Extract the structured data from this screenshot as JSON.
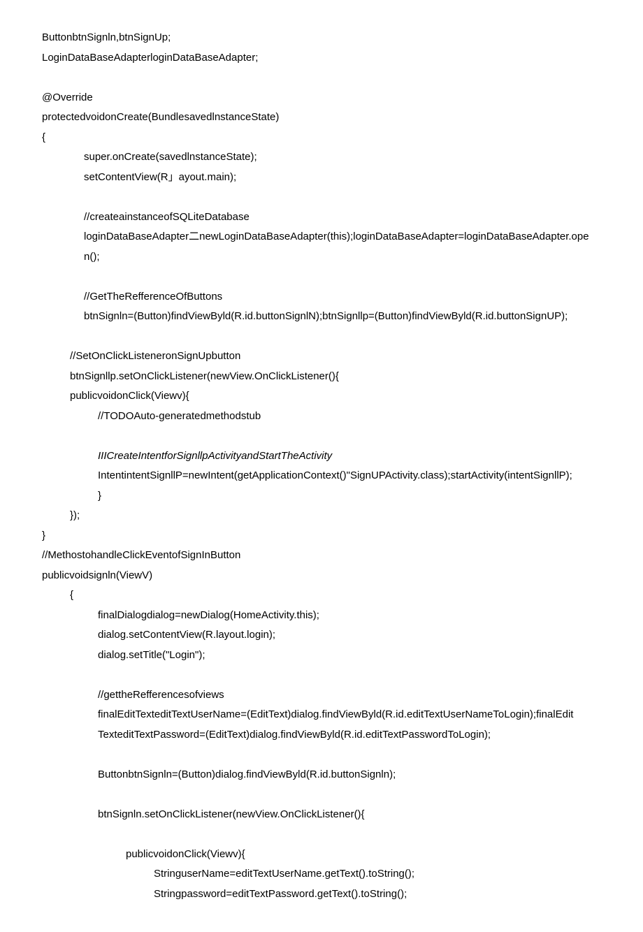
{
  "code": {
    "lines": [
      {
        "text": "ButtonbtnSignln,btnSignUp;",
        "indent": 0
      },
      {
        "text": "LoginDataBaseAdapterloginDataBaseAdapter;",
        "indent": 0
      },
      {
        "text": "",
        "indent": 0,
        "blank": true
      },
      {
        "text": "@Override",
        "indent": 0
      },
      {
        "text": "protectedvoidonCreate(BundlesavedlnstanceState)",
        "indent": 0
      },
      {
        "text": "{",
        "indent": 0
      },
      {
        "text": "super.onCreate(savedlnstanceState);",
        "indent": 1
      },
      {
        "text": "setContentView(R」ayout.main);",
        "indent": 1
      },
      {
        "text": "",
        "indent": 0,
        "blank": true
      },
      {
        "text": "//createainstanceofSQLiteDatabase",
        "indent": 1
      },
      {
        "text": "loginDataBaseAdapter二newLoginDataBaseAdapter(this);loginDataBaseAdapter=loginDataBaseAdapter.ope",
        "indent": 1
      },
      {
        "text": "n();",
        "indent": 1
      },
      {
        "text": "",
        "indent": 0,
        "blank": true
      },
      {
        "text": "//GetTheRefferenceOfButtons",
        "indent": 1
      },
      {
        "text": "btnSignln=(Button)findViewByld(R.id.buttonSignlN);btnSignllp=(Button)findViewByld(R.id.buttonSignUP);",
        "indent": 1
      },
      {
        "text": "",
        "indent": 0,
        "blank": true
      },
      {
        "text": "//SetOnClickListeneronSignUpbutton",
        "indent": 2
      },
      {
        "text": "btnSignllp.setOnClickListener(newView.OnClickListener(){",
        "indent": 2
      },
      {
        "text": "publicvoidonClick(Viewv){",
        "indent": 2
      },
      {
        "text": "//TODOAuto-generatedmethodstub",
        "indent": 3
      },
      {
        "text": "",
        "indent": 0,
        "blank": true
      },
      {
        "text": "IIICreateIntentforSignllpActivityandStartTheActivity",
        "indent": 3,
        "italic": true
      },
      {
        "text": "IntentintentSignllP=newIntent(getApplicationContext()\"SignUPActivity.class);startActivity(intentSignllP);",
        "indent": 3
      },
      {
        "text": "}",
        "indent": 3
      },
      {
        "text": "});",
        "indent": 2
      },
      {
        "text": "}",
        "indent": 0
      },
      {
        "text": "//MethostohandleClickEventofSignInButton",
        "indent": 0
      },
      {
        "text": "publicvoidsignln(ViewV)",
        "indent": 0
      },
      {
        "text": "{",
        "indent": 2
      },
      {
        "text": "finalDialogdialog=newDialog(HomeActivity.this);",
        "indent": 4
      },
      {
        "text": "dialog.setContentView(R.layout.login);",
        "indent": 4
      },
      {
        "text": "dialog.setTitle(\"Login\");",
        "indent": 4
      },
      {
        "text": "",
        "indent": 0,
        "blank": true
      },
      {
        "text": "//gettheRefferencesofviews",
        "indent": 4
      },
      {
        "text": "finalEditTexteditTextUserName=(EditText)dialog.findViewByld(R.id.editTextUserNameToLogin);finalEdit",
        "indent": 4
      },
      {
        "text": "TexteditTextPassword=(EditText)dialog.findViewByld(R.id.editTextPasswordToLogin);",
        "indent": 4
      },
      {
        "text": "",
        "indent": 0,
        "blank": true
      },
      {
        "text": "ButtonbtnSignln=(Button)dialog.findViewByld(R.id.buttonSignln);",
        "indent": 4
      },
      {
        "text": "",
        "indent": 0,
        "blank": true
      },
      {
        "text": "btnSignln.setOnClickListener(newView.OnClickListener(){",
        "indent": 4
      },
      {
        "text": "",
        "indent": 0,
        "blank": true
      },
      {
        "text": "publicvoidonClick(Viewv){",
        "indent": 5
      },
      {
        "text": "StringuserName=editTextUserName.getText().toString();",
        "indent": 6
      },
      {
        "text": "Stringpassword=editTextPassword.getText().toString();",
        "indent": 6
      }
    ]
  }
}
